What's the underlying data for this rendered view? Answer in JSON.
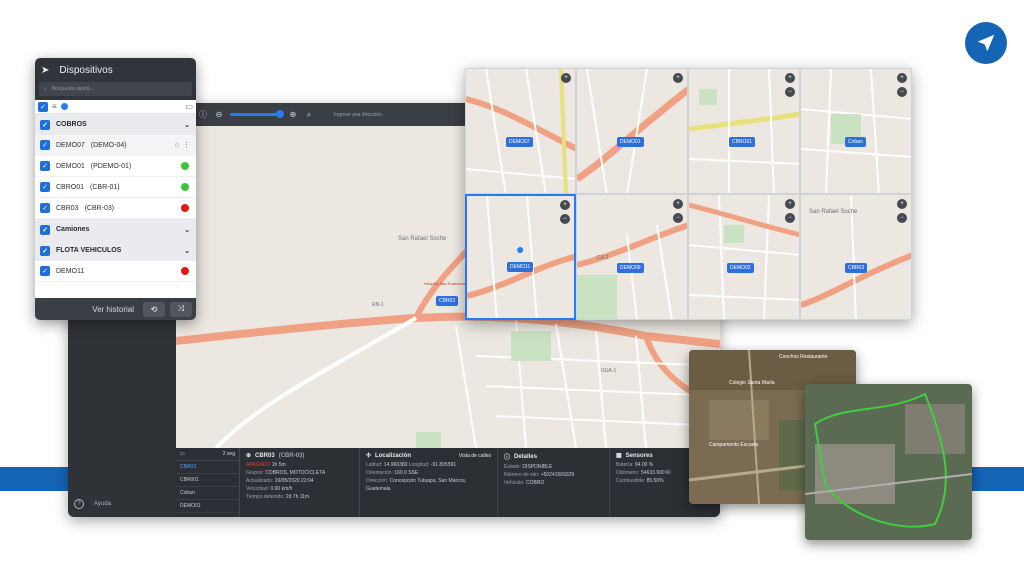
{
  "panel": {
    "title": "Dispositivos",
    "search_placeholder": "Búsqueda rápida...",
    "groups": [
      {
        "name": "COBROS"
      },
      {
        "name": "Camiones"
      },
      {
        "name": "FLOTA VEHICULOS"
      }
    ],
    "items_cobros": [
      {
        "name": "DEMO07",
        "code": "(DEMO-04)"
      },
      {
        "name": "DEMO01",
        "code": "(PDEMO-01)",
        "status": "#3cc43c"
      },
      {
        "name": "CBRO01",
        "code": "(CBR-01)",
        "status": "#3cc43c"
      },
      {
        "name": "CBR03",
        "code": "(CBR-03)",
        "status": "#e01818"
      }
    ],
    "items_flota": [
      {
        "name": "DEMO11",
        "status": "#e01818"
      }
    ],
    "footer_label": "Ver historial"
  },
  "toolbar": {
    "address_placeholder": "Ingrese una dirección..."
  },
  "sidebar": {
    "help_label": "Ayuda"
  },
  "map_main": {
    "place": "San Rafael Soche",
    "road": "RN-1",
    "marker": "CBR03",
    "hospital": "Hospital San Francisco",
    "road2": "GUA-1"
  },
  "info": {
    "list_header_right": "2 seg",
    "list": [
      "CBR03",
      "CBR001",
      "Coban",
      "DEMO01"
    ],
    "device": {
      "name": "CBR03",
      "code": "(CBR-03)",
      "rows": [
        {
          "k": "APAGADO",
          "v": "1h 5m"
        },
        {
          "k": "Grupos:",
          "v": "COBROS, MOTOCICLETA"
        },
        {
          "k": "Actualizado:",
          "v": "19/05/2020 22:04"
        },
        {
          "k": "Velocidad:",
          "v": "0.00 km/h"
        },
        {
          "k": "Tiempo detenido:",
          "v": "2d 7h 11m"
        }
      ]
    },
    "location": {
      "title": "Localización",
      "street_view": "Vista de calles",
      "lat_k": "Latitud:",
      "lat_v": "14.966380",
      "lon_k": "Longitud:",
      "lon_v": "-91.805591",
      "orient_k": "Orientación:",
      "orient_v": "160.0 SSE",
      "dir_k": "Dirección:",
      "dir_v": "Concepción Tutuapa, San Marcos,",
      "dir_v2": "Guatemala"
    },
    "details": {
      "title": "Detalles",
      "rows": [
        {
          "k": "Estado:",
          "v": "DISPONIBLE"
        },
        {
          "k": "Número de sim:",
          "v": "+50241569329"
        },
        {
          "k": "Vehículo:",
          "v": "COBRO"
        }
      ]
    },
    "sensors": {
      "title": "Sensores",
      "rows": [
        {
          "k": "Batería:",
          "v": "94.00 %"
        },
        {
          "k": "Odómetro:",
          "v": "54633.900 Kl"
        },
        {
          "k": "Combustible:",
          "v": "85.50%"
        }
      ]
    }
  },
  "grid_tags": [
    "DEMO07",
    "DEMO01",
    "CBRO01",
    "Coban",
    "DEMO11",
    "DEMO09",
    "DEMO02",
    "CBR03"
  ],
  "grid_labels": {
    "place": "San Rafael Soche",
    "road": "CA-2"
  },
  "sat_labels": {
    "a": "Conchos Restaurante",
    "b": "Colegio Santa María",
    "c": "Campamento Escuela"
  }
}
